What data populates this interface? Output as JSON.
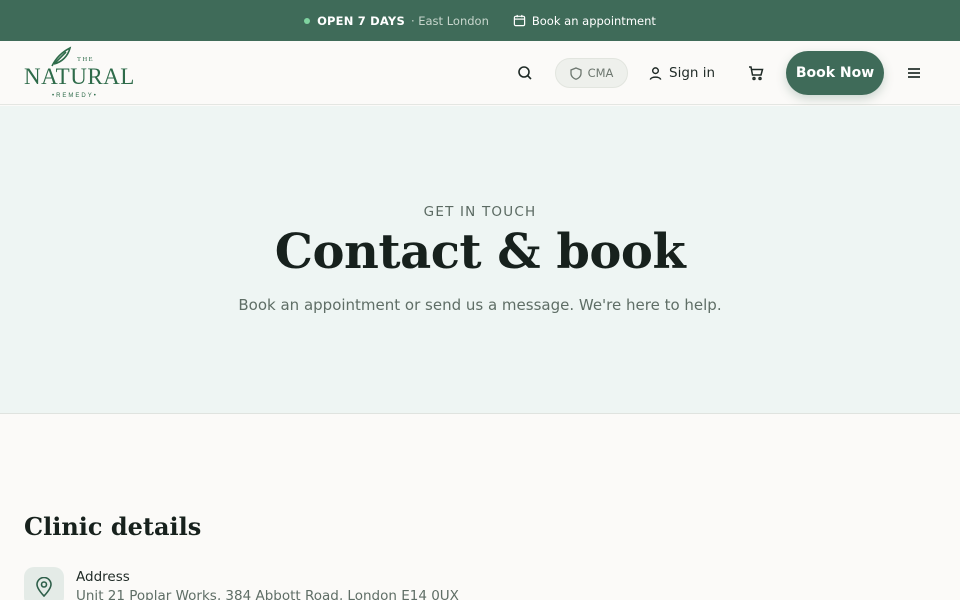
{
  "topbar": {
    "open_label": "OPEN 7 DAYS",
    "location": "· East London",
    "appointment_link": "Book an appointment",
    "status_dot_color": "#7fd3a0"
  },
  "header": {
    "logo": {
      "the": "THE",
      "natural": "NATURAL",
      "remedy": "•REMEDY•"
    },
    "cma_badge": "CMA",
    "signin_label": "Sign in",
    "book_now_label": "Book Now",
    "icons": [
      "search-icon",
      "shield-icon",
      "user-icon",
      "cart-icon",
      "menu-icon",
      "calendar-icon",
      "leaf-icon"
    ]
  },
  "hero": {
    "eyebrow": "GET IN TOUCH",
    "title": "Contact & book",
    "subtitle": "Book an appointment or send us a message. We're here to help."
  },
  "clinic": {
    "title": "Clinic details",
    "address_label": "Address",
    "address_value": "Unit 21 Poplar Works, 384 Abbott Road, London E14 0UX"
  },
  "colors": {
    "brand_green": "#3f6b59",
    "logo_green": "#2e6b4a",
    "hero_bg": "#eef5f3",
    "page_bg": "#fbfaf8"
  }
}
